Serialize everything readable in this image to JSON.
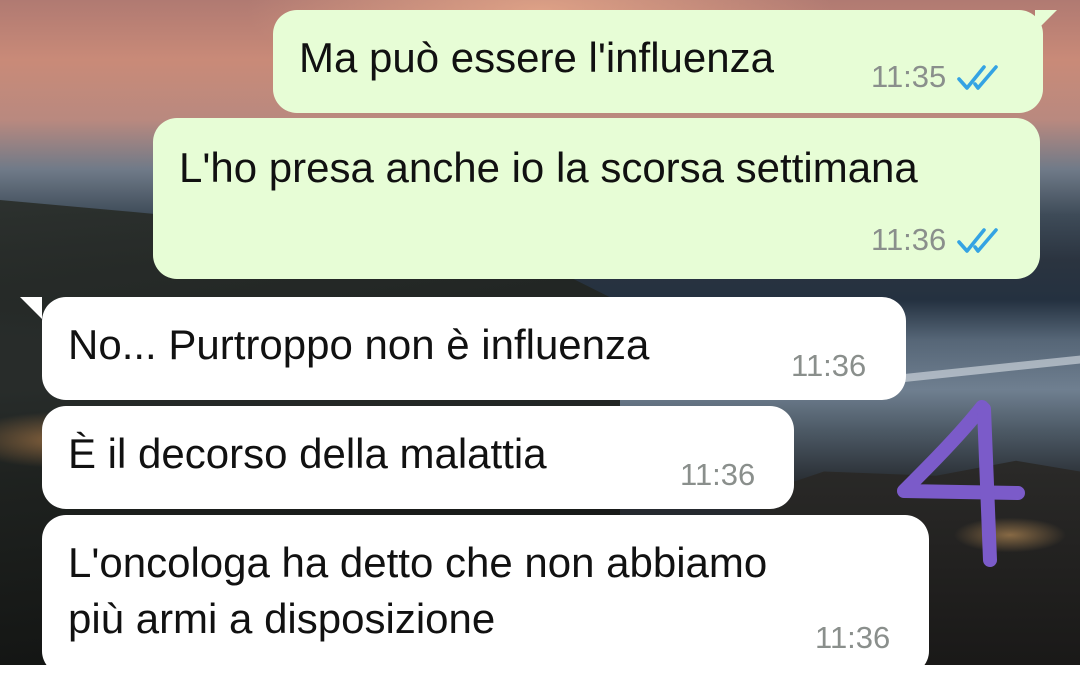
{
  "conversation": {
    "messages": [
      {
        "direction": "out",
        "text": "Ma può essere l'influenza",
        "time": "11:35",
        "status": "read"
      },
      {
        "direction": "out",
        "text": "L'ho presa anche io la scorsa settimana",
        "time": "11:36",
        "status": "read"
      },
      {
        "direction": "in",
        "text": "No... Purtroppo non è influenza",
        "time": "11:36"
      },
      {
        "direction": "in",
        "text": "È il decorso della malattia",
        "time": "11:36"
      },
      {
        "direction": "in",
        "lines": [
          "L'oncologa ha detto che non abbiamo",
          "più armi a disposizione"
        ],
        "time": "11:36"
      }
    ]
  },
  "annotation": {
    "handwritten_number": "4",
    "color": "#7b5bc9"
  },
  "colors": {
    "outgoing_bubble": "#e7fdd6",
    "incoming_bubble": "#ffffff",
    "timestamp": "#8a8f8c",
    "read_ticks": "#34a3e3"
  },
  "icons": {
    "read_receipt": "double-check-icon"
  }
}
